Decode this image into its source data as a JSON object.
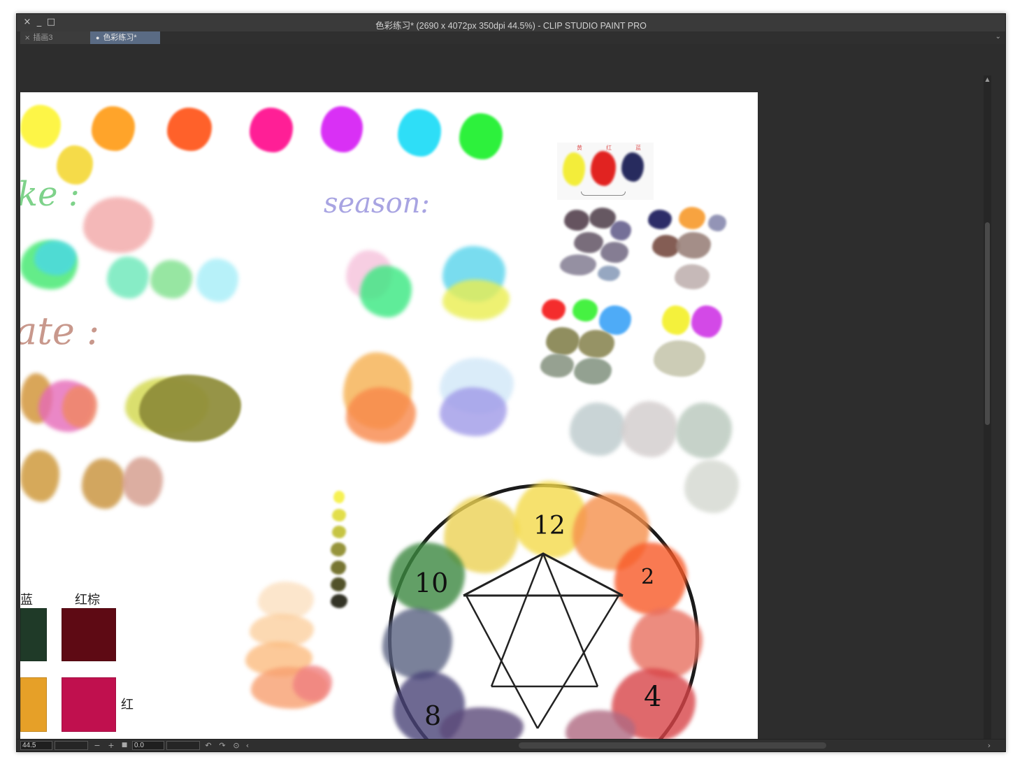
{
  "window": {
    "title": "色彩练习* (2690 x 4072px 350dpi 44.5%)  - CLIP STUDIO PAINT PRO",
    "controls": [
      "×",
      "_",
      "□"
    ]
  },
  "tabs": [
    {
      "label": "插画3",
      "icon": "×",
      "active": false
    },
    {
      "label": "色彩练习*",
      "icon": "●",
      "active": true
    }
  ],
  "tab_menu_icon": "⌄",
  "canvas": {
    "handwritten": {
      "ke": "ke :",
      "ate": "ate :",
      "season": "season:",
      "wheel_numbers": [
        "12",
        "2",
        "4",
        "8",
        "10"
      ],
      "primary_labels": [
        "黄",
        "红",
        "蓝"
      ],
      "swatch_labels": [
        "蓝",
        "红棕",
        "红"
      ]
    }
  },
  "statusbar": {
    "zoom": "44.5",
    "rotation": "0.0",
    "zoom_out": "−",
    "zoom_in": "+",
    "fit": "■",
    "undo": "↶",
    "redo": "↷",
    "reset": "⊙",
    "scroll_left": "‹",
    "scroll_right": "›"
  },
  "colors": {
    "window_bg": "#2d2d2d",
    "titlebar": "#3a3a3a",
    "active_tab": "#5a6b84",
    "canvas": "#ffffff"
  }
}
